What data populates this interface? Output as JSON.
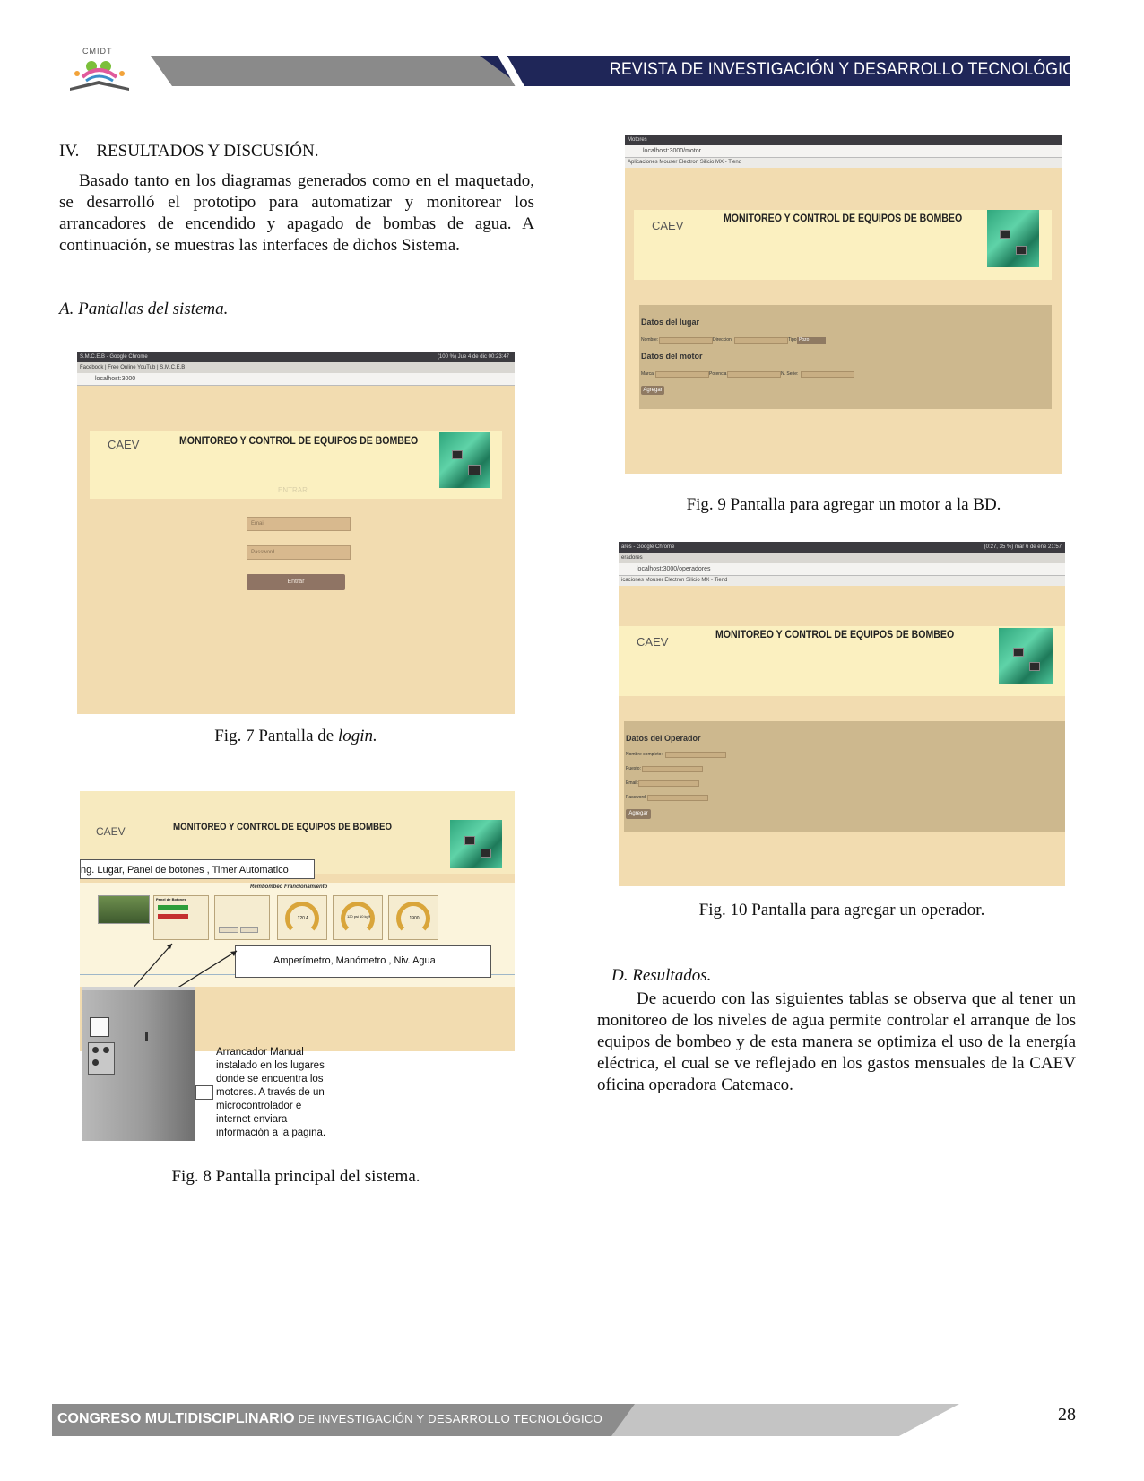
{
  "header": {
    "logo_text": "CMIDT",
    "journal_title": "REVISTA DE INVESTIGACIÓN Y DESARROLLO TECNOLÓGICO"
  },
  "section": {
    "heading": "IV.    RESULTADOS Y DISCUSIÓN.",
    "paragraph": "Basado tanto en los diagramas generados como en el maquetado, se desarrolló el prototipo para automatizar y monitorear los arrancadores de encendido y apagado de bombas de agua. A continuación, se muestras las interfaces de dichos Sistema.",
    "subheading": "A. Pantallas del sistema."
  },
  "app": {
    "banner_title": "MONITOREO Y CONTROL DE EQUIPOS DE BOMBEO",
    "org": "CAEV"
  },
  "fig7": {
    "window_title": "S.M.C.E.B - Google Chrome",
    "tabs": "Facebook   |   Free Online YouTub   |   S.M.C.E.B",
    "status": "(100 %)   Jue 4 de dic 00:23:47",
    "url": "localhost:3000",
    "subtitle": "ENTRAR",
    "user_placeholder": "Email",
    "password_placeholder": "Password",
    "button": "Entrar",
    "caption_prefix": "Fig. 7 Pantalla de ",
    "caption_italic": "login."
  },
  "fig8": {
    "callout_top": "ng. Lugar, Panel de botones , Timer Automatico",
    "panel_heading": "Rembombeo Francionamiento",
    "panel_buttons": "Panel de Botones",
    "gauges": [
      "120 A",
      "120 psi 10 kg/f",
      "1900"
    ],
    "callout_mid": "Amperímetro, Manómetro , Niv. Agua",
    "callout_bottom": "Arrancador Manual instalado en los lugares donde se encuentra los motores. A través de un microcontrolador e internet enviara información a la pagina.",
    "caption": "Fig. 8 Pantalla principal del sistema."
  },
  "fig9": {
    "tab": "Motores",
    "url": "localhost:3000/motor",
    "bookmarks": "Aplicaciones   Mouser Electron   Silicio MX - Tiend",
    "group1": "Datos del lugar",
    "labels1": [
      "Nombre:",
      "Direccion:",
      "Tipo:"
    ],
    "select_value": "Pozo",
    "group2": "Datos del motor",
    "labels2": [
      "Marca:",
      "Potencia:",
      "N. Serie:"
    ],
    "button": "Agregar",
    "caption": "Fig. 9 Pantalla para agregar un motor a la BD."
  },
  "fig10": {
    "window_title": "ares - Google Chrome",
    "tab": "eradores",
    "status": "(0:27, 35 %)   mar 6 de ene 21:57",
    "url": "localhost:3000/operadores",
    "bookmarks": "icaciones   Mouser Electron   Silicio MX - Tiend",
    "group": "Datos del Operador",
    "labels": [
      "Nombre completo:",
      "Puesto:",
      "Email:",
      "Password:"
    ],
    "button": "Agregar",
    "caption": "Fig. 10 Pantalla para agregar un operador."
  },
  "results": {
    "subheading": "D. Resultados.",
    "paragraph": "De acuerdo con las siguientes tablas se observa que al tener un monitoreo de los niveles de agua permite controlar el arranque de los equipos de bombeo y de esta manera se optimiza el uso de la energía eléctrica, el cual se ve reflejado en los gastos mensuales de la CAEV oficina operadora Catemaco."
  },
  "footer": {
    "bold": "CONGRESO MULTIDISCIPLINARIO",
    "rest": " DE INVESTIGACIÓN Y DESARROLLO TECNOLÓGICO",
    "page_number": "28"
  }
}
